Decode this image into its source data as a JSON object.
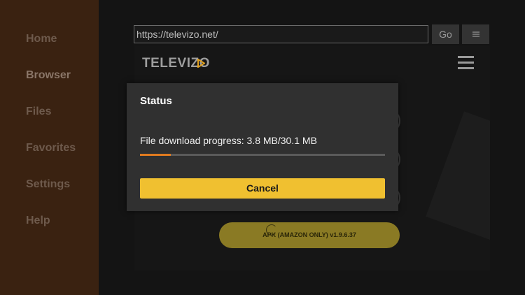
{
  "sidebar": {
    "items": [
      {
        "label": "Home"
      },
      {
        "label": "Browser",
        "active": true
      },
      {
        "label": "Files"
      },
      {
        "label": "Favorites"
      },
      {
        "label": "Settings"
      },
      {
        "label": "Help"
      }
    ]
  },
  "toolbar": {
    "url": "https://televizo.net/",
    "go_label": "Go",
    "menu_icon": "menu-icon"
  },
  "webpage": {
    "logo_text": "TELEVIZO",
    "logo_icon": "play-triangle-icon",
    "menu_icon": "hamburger-icon",
    "apk_button_label": "APK (AMAZON ONLY) v1.9.6.37"
  },
  "dialog": {
    "title": "Status",
    "progress_text": "File download progress: 3.8 MB/30.1 MB",
    "progress_fraction": 0.126,
    "cancel_label": "Cancel"
  },
  "colors": {
    "sidebar_bg": "#3a2211",
    "accent_yellow": "#f0c030",
    "progress_orange": "#e07a1f",
    "dialog_bg": "#303030"
  }
}
